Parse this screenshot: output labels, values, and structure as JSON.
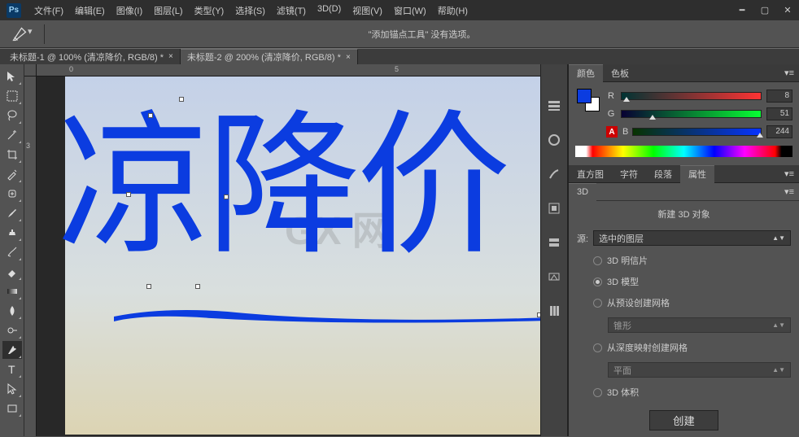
{
  "menubar": {
    "items": [
      "文件(F)",
      "编辑(E)",
      "图像(I)",
      "图层(L)",
      "类型(Y)",
      "选择(S)",
      "滤镜(T)",
      "3D(D)",
      "视图(V)",
      "窗口(W)",
      "帮助(H)"
    ]
  },
  "optionsbar": {
    "message": "\"添加锚点工具\" 没有选项。"
  },
  "tabs": [
    {
      "label": "未标题-1 @ 100% (清凉降价, RGB/8) *",
      "active": false
    },
    {
      "label": "未标题-2 @ 200% (清凉降价, RGB/8) *",
      "active": true
    }
  ],
  "canvas_text": "凉降价",
  "watermark": "GX 网",
  "ruler_h": [
    "0",
    "5"
  ],
  "ruler_v": [
    "3"
  ],
  "color_panel": {
    "tabs": [
      "颜色",
      "色板"
    ],
    "channels": [
      {
        "label": "R",
        "value": "8",
        "track": "linear-gradient(90deg,#003333,#ff3333)",
        "thumb": 2
      },
      {
        "label": "G",
        "value": "51",
        "track": "linear-gradient(90deg,#080033,#08ff33)",
        "thumb": 20
      },
      {
        "label": "B",
        "value": "244",
        "track": "linear-gradient(90deg,#083300,#0833ff)",
        "thumb": 96
      }
    ]
  },
  "prop_panel": {
    "tabs": [
      "直方图",
      "字符",
      "段落",
      "属性"
    ],
    "sub_tab": "3D",
    "section_title": "新建 3D 对象",
    "source_label": "源:",
    "source_value": "选中的图层",
    "options": [
      {
        "label": "3D 明信片",
        "selected": false,
        "type": "radio"
      },
      {
        "label": "3D 模型",
        "selected": true,
        "type": "radio"
      },
      {
        "label": "从预设创建网格",
        "selected": false,
        "type": "radio",
        "sub": "锥形"
      },
      {
        "label": "从深度映射创建网格",
        "selected": false,
        "type": "radio",
        "sub": "平面"
      },
      {
        "label": "3D 体积",
        "selected": false,
        "type": "radio"
      }
    ],
    "create_label": "创建"
  }
}
